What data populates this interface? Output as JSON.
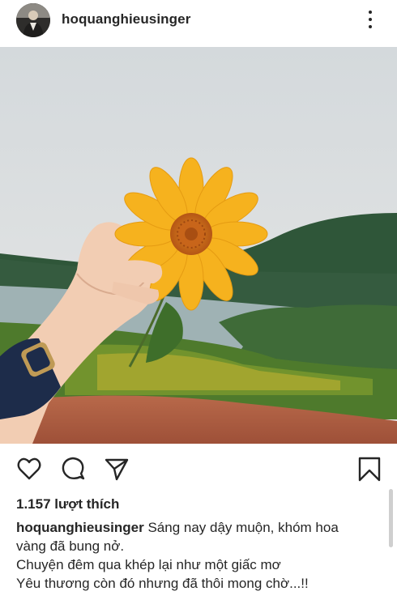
{
  "post": {
    "username": "hoquanghieusinger",
    "likes": "1.157 lượt thích",
    "caption_user": "hoquanghieusinger",
    "caption_lines": [
      "Sáng nay dậy muộn, khóm hoa",
      "vàng đã bung nở.",
      "Chuyện đêm qua khép lại như một giấc mơ",
      "Yêu thương còn đó nhưng đã thôi mong chờ...!!"
    ]
  },
  "icons": {
    "header": [
      "avatar",
      "more-options-icon"
    ],
    "actions": [
      "heart-icon",
      "comment-icon",
      "share-icon",
      "bookmark-icon"
    ]
  },
  "colors": {
    "text": "#262626",
    "flower": "#f6b21e",
    "flower_center": "#c7661a",
    "sky": "#d9dde0",
    "hills": "#2f5a3c",
    "ground": "#a85a3c"
  }
}
